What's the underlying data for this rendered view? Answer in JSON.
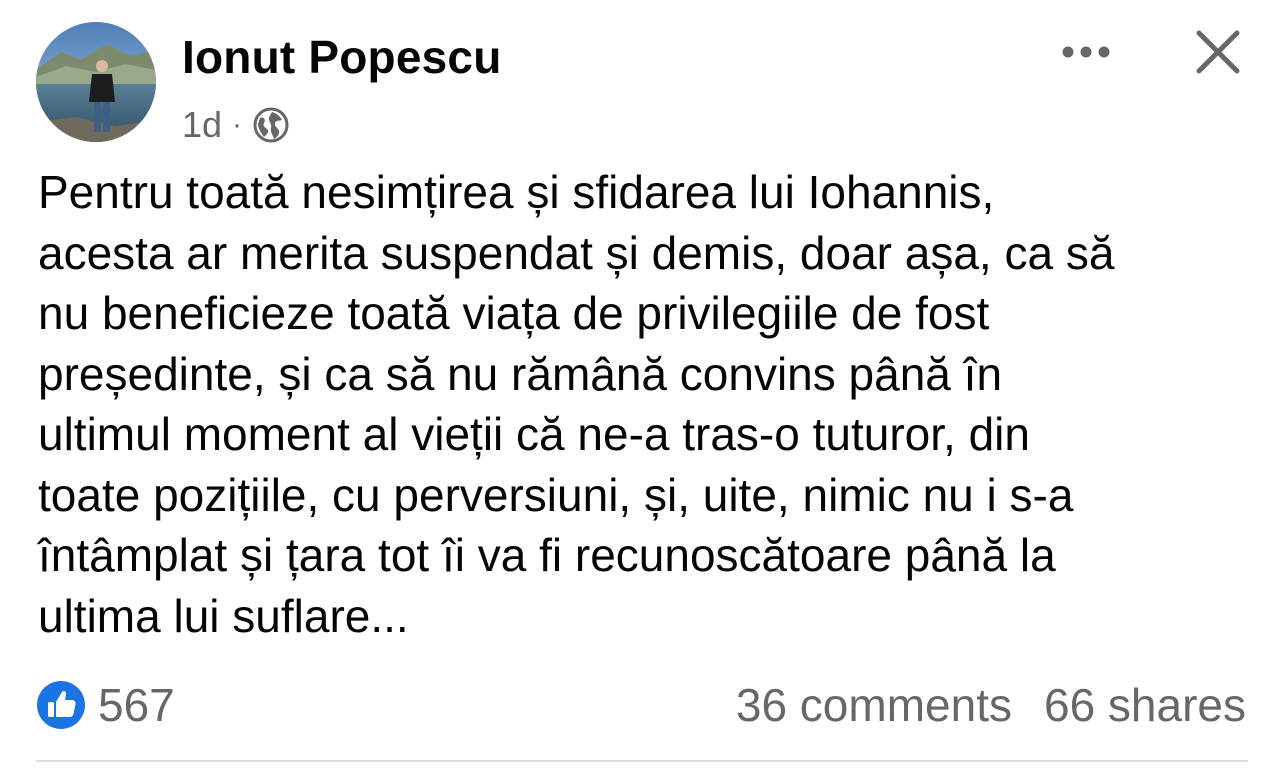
{
  "post": {
    "author": "Ionut Popescu",
    "time": "1d",
    "separator": "·",
    "audience_icon": "globe-icon",
    "text": "Pentru toată nesimțirea și sfidarea lui Iohannis,\nacesta ar merita suspendat și demis, doar așa, ca să\nnu beneficieze toată viața de privilegiile de fost\npreședinte, și ca să nu rămână convins până în\nultimul moment al vieții că ne-a tras-o tuturor, din\ntoate pozițiile, cu perversiuni, și, uite, nimic nu i s-a\nîntâmplat și țara tot îi va fi recunoscătoare până la\nultima lui suflare..."
  },
  "header_actions": {
    "more_icon": "more-options-icon",
    "close_icon": "close-icon"
  },
  "engagement": {
    "reaction_icon": "like-icon",
    "reactions_count": "567",
    "comments": "36 comments",
    "shares": "66 shares"
  },
  "colors": {
    "text_primary": "#050505",
    "text_secondary": "#65676b",
    "like_blue": "#1b74e4",
    "divider": "#dadde1"
  }
}
